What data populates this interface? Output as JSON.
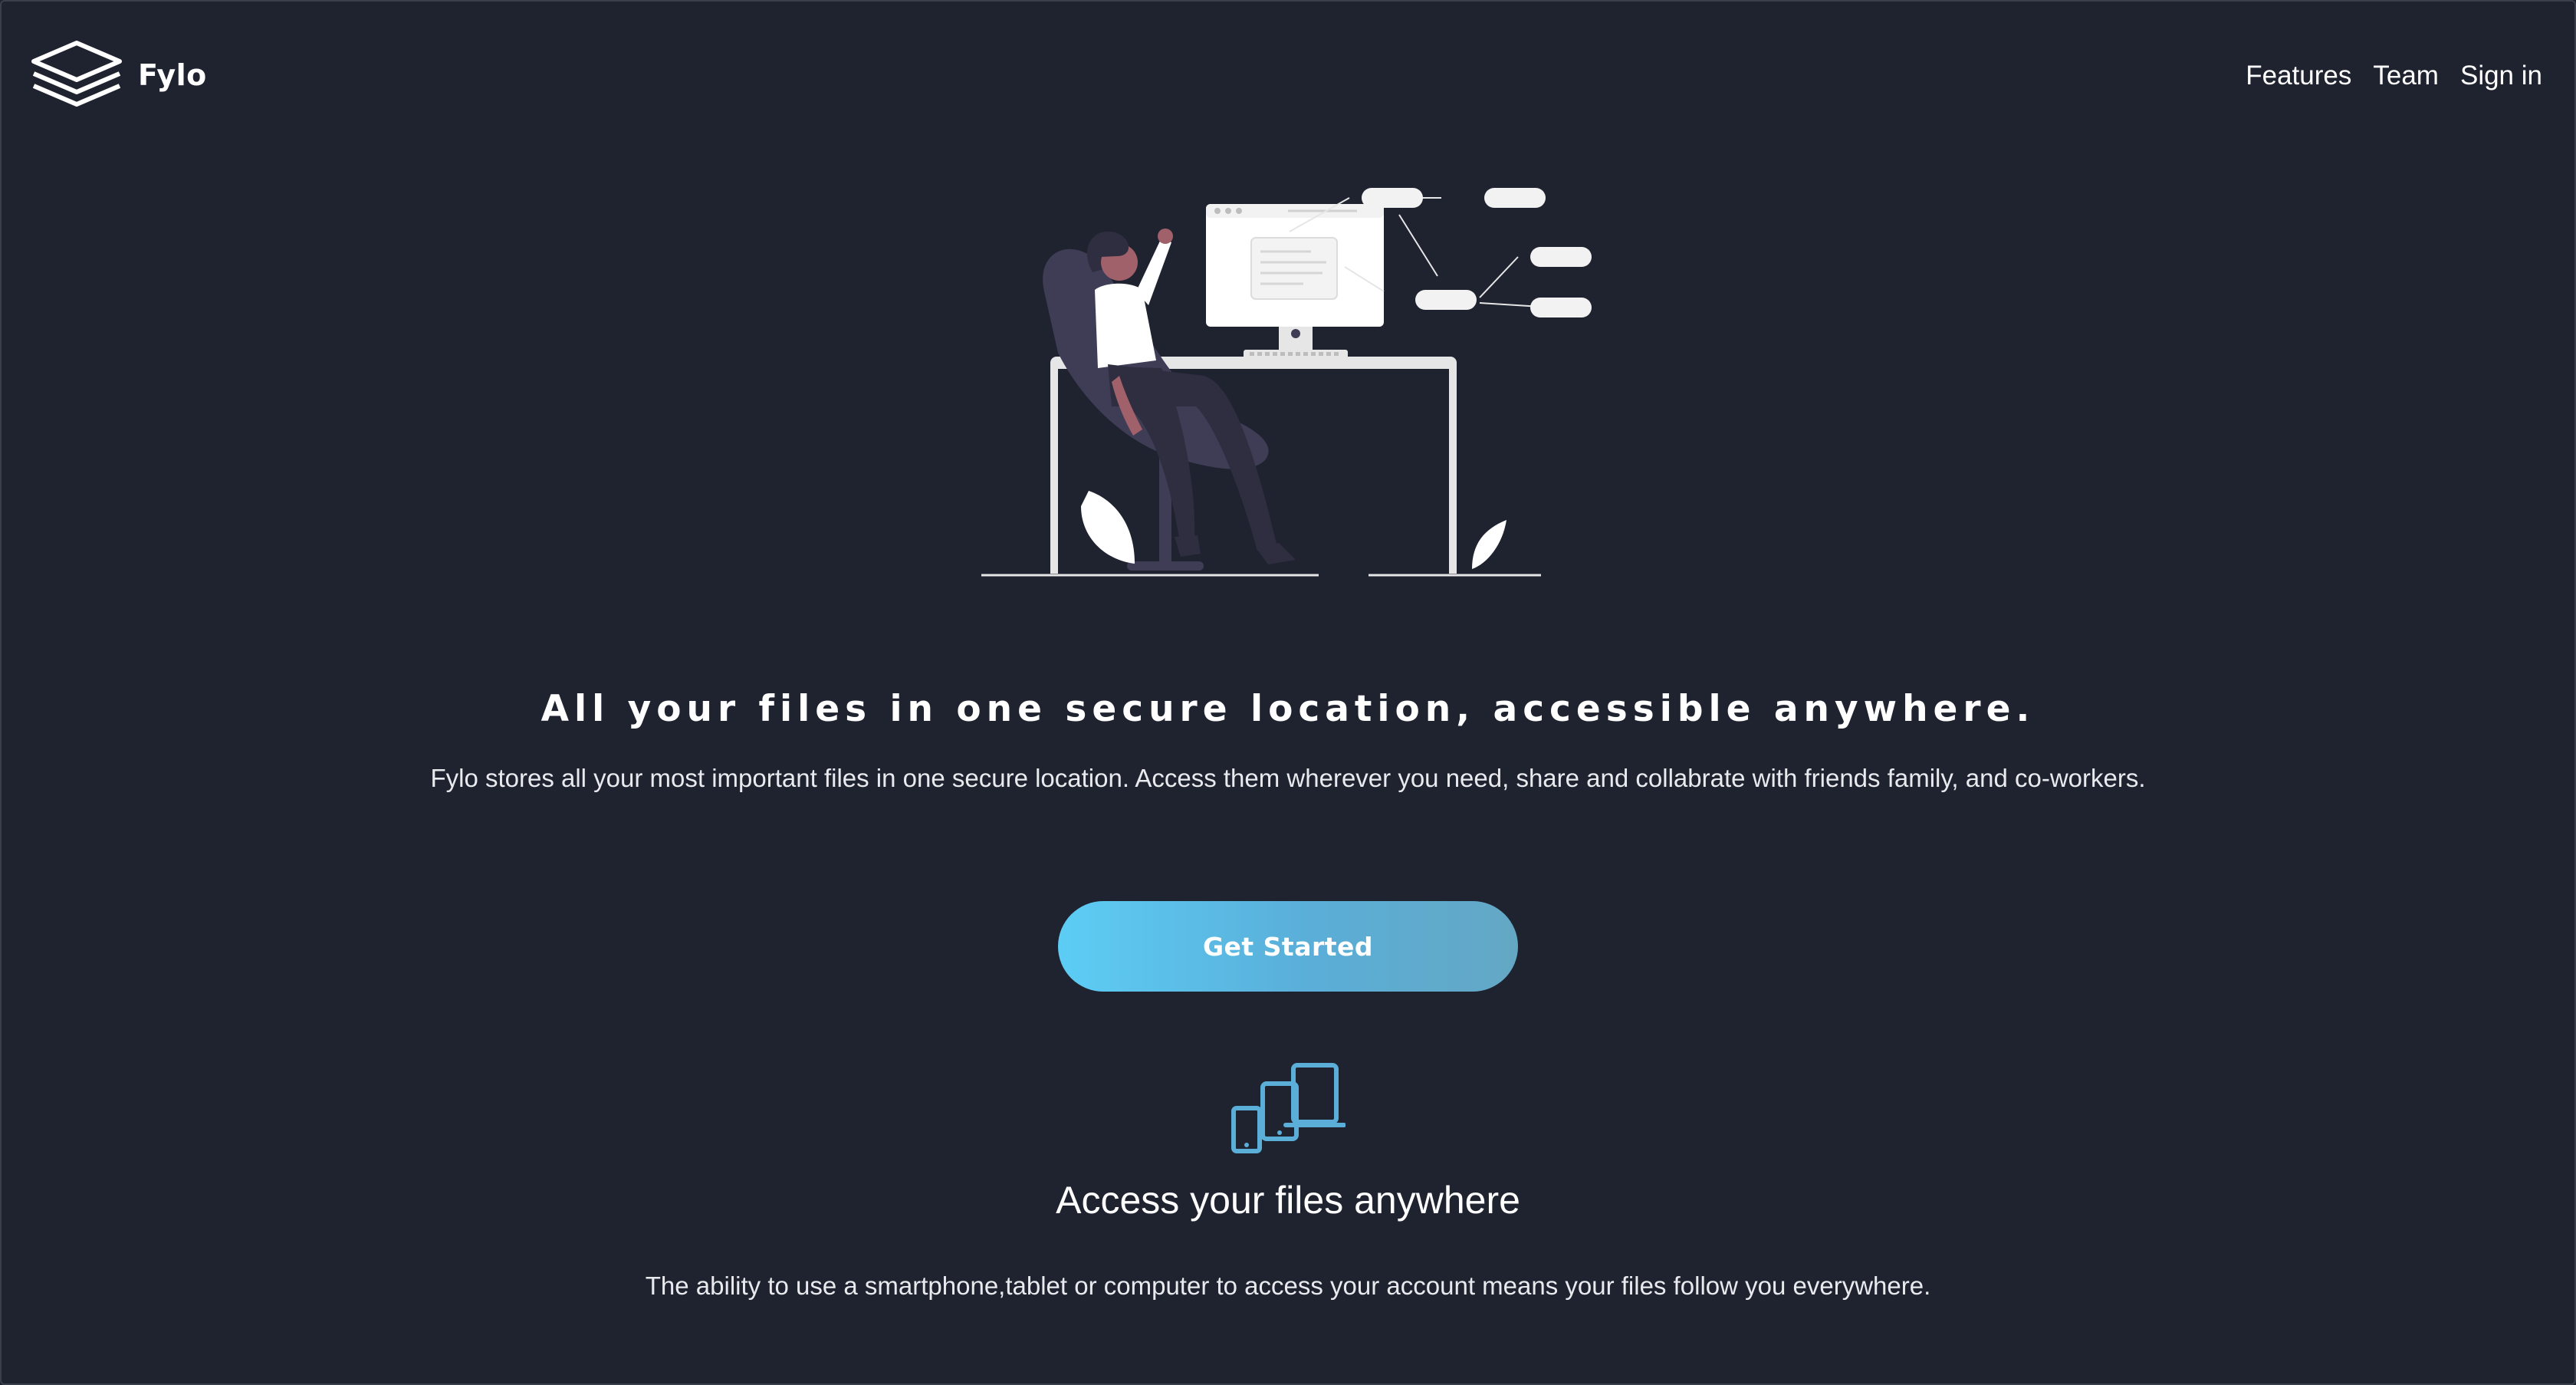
{
  "brand": {
    "name": "Fylo",
    "logo_icon": "stacked-layers-icon"
  },
  "nav": {
    "items": [
      {
        "label": "Features"
      },
      {
        "label": "Team"
      },
      {
        "label": "Sign in"
      }
    ]
  },
  "hero": {
    "illustration": "person-at-desk-illustration",
    "title": "All your files in one secure location, accessible anywhere.",
    "subtitle": "Fylo stores all your most important files in one secure location. Access them wherever you need, share and collabrate with friends family, and co-workers.",
    "cta_label": "Get Started"
  },
  "feature": {
    "icon": "devices-icon",
    "title": "Access your files anywhere",
    "text": "The ability to use a smartphone,tablet or computer to access your account means your files follow you everywhere."
  },
  "colors": {
    "background": "#1f2330",
    "text": "#ffffff",
    "accent_start": "#5ccdf5",
    "accent_end": "#64a7c4",
    "icon_accent": "#5aaed8"
  }
}
